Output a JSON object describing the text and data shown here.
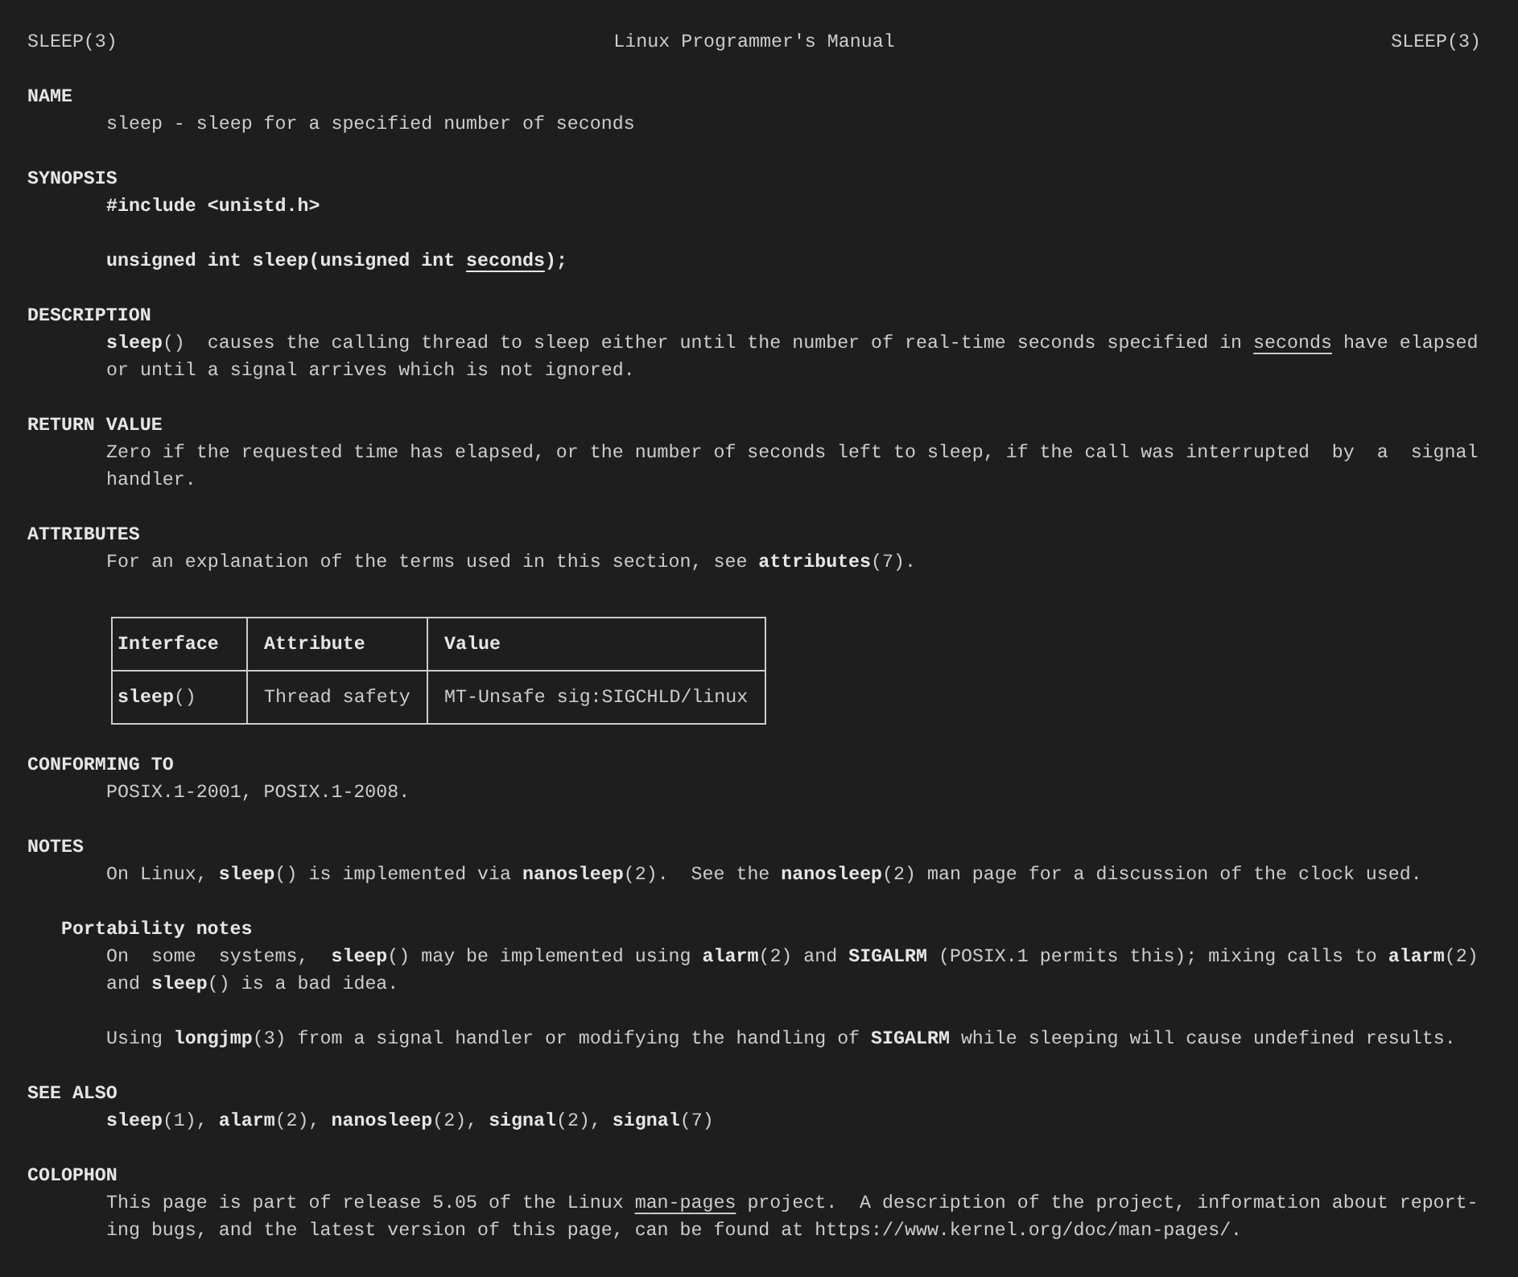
{
  "header": {
    "left": "SLEEP(3)",
    "center": "Linux Programmer's Manual",
    "right": "SLEEP(3)"
  },
  "sections": [
    {
      "title": "NAME",
      "blocks": [
        {
          "kind": "text",
          "lines": [
            "sleep - sleep for a specified number of seconds"
          ]
        }
      ]
    },
    {
      "title": "SYNOPSIS",
      "blocks": [
        {
          "kind": "synopsis",
          "lines": [
            "#include <unistd.h>"
          ]
        },
        {
          "kind": "synopsis",
          "lines": [
            "unsigned int sleep(unsigned int *seconds*);"
          ]
        }
      ]
    },
    {
      "title": "DESCRIPTION",
      "blocks": [
        {
          "kind": "text",
          "lines": [
            "**sleep**()  causes the calling thread to sleep either until the number of real-time seconds specified in *seconds* have elapsed",
            "or until a signal arrives which is not ignored."
          ]
        }
      ]
    },
    {
      "title": "RETURN VALUE",
      "blocks": [
        {
          "kind": "text",
          "lines": [
            "Zero if the requested time has elapsed, or the number of seconds left to sleep, if the call was interrupted  by  a  signal",
            "handler."
          ]
        }
      ]
    },
    {
      "title": "ATTRIBUTES",
      "blocks": [
        {
          "kind": "text",
          "lines": [
            "For an explanation of the terms used in this section, see **attributes**(7)."
          ]
        },
        {
          "kind": "table",
          "columns": [
            "Interface",
            "Attribute",
            "Value"
          ],
          "rows": [
            [
              "**sleep**()",
              "Thread safety",
              "MT-Unsafe sig:SIGCHLD/linux"
            ]
          ]
        }
      ]
    },
    {
      "title": "CONFORMING TO",
      "blocks": [
        {
          "kind": "text",
          "lines": [
            "POSIX.1-2001, POSIX.1-2008."
          ]
        }
      ]
    },
    {
      "title": "NOTES",
      "blocks": [
        {
          "kind": "text",
          "lines": [
            "On Linux, **sleep**() is implemented via **nanosleep**(2).  See the **nanosleep**(2) man page for a discussion of the clock used."
          ]
        },
        {
          "kind": "subheading",
          "title": "Portability notes"
        },
        {
          "kind": "text",
          "lines": [
            "On  some  systems,  **sleep**() may be implemented using **alarm**(2) and **SIGALRM** (POSIX.1 permits this); mixing calls to **alarm**(2)",
            "and **sleep**() is a bad idea."
          ]
        },
        {
          "kind": "text",
          "lines": [
            "Using **longjmp**(3) from a signal handler or modifying the handling of **SIGALRM** while sleeping will cause undefined results."
          ]
        }
      ]
    },
    {
      "title": "SEE ALSO",
      "blocks": [
        {
          "kind": "text",
          "lines": [
            "**sleep**(1), **alarm**(2), **nanosleep**(2), **signal**(2), **signal**(7)"
          ]
        }
      ]
    },
    {
      "title": "COLOPHON",
      "blocks": [
        {
          "kind": "text",
          "lines": [
            "This page is part of release 5.05 of the Linux *man-pages* project.  A description of the project, information about report-",
            "ing bugs, and the latest version of this page, can be found at https://www.kernel.org/doc/man-pages/."
          ]
        }
      ]
    }
  ]
}
